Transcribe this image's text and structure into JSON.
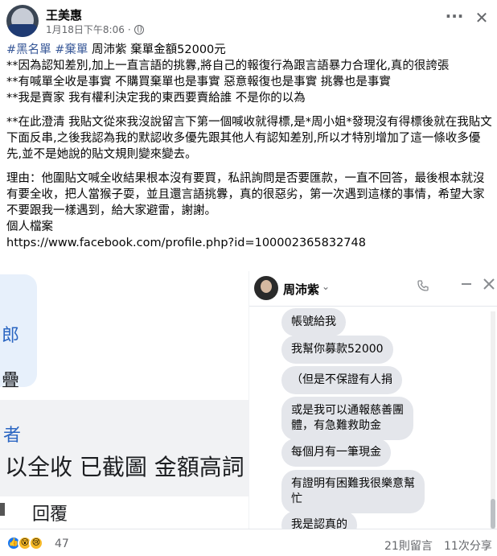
{
  "post": {
    "author": "王美惠",
    "timestamp": "1月18日下午8:06",
    "more_label": "···",
    "close_label": "✕",
    "line1_tag1": "#黑名單",
    "line1_tag2": "#棄單",
    "line1_rest": " 周沛紫 棄單金額52000元",
    "line2": "**因為認知差別,加上一直言語的挑釁,將自己的報復行為跟言語暴力合理化,真的很誇張",
    "line3": "**有喊單全收是事實 不購買棄單也是事實 惡意報復也是事實 挑釁也是事實",
    "line4": "**我是賣家 我有權利決定我的東西要賣給誰 不是你的以為",
    "para2": "**在此澄清 我貼文從來我沒說留言下第一個喊收就得標,是*周小姐*發現沒有得標後就在我貼文下面反串,之後我認為我的默認收多優先跟其他人有認知差別,所以才特別增加了這一條收多優先,並不是她說的貼文規則變來變去。",
    "para3": "理由：他圍貼文喊全收結果根本沒有要買，私訊詢問是否要匯款，一直不回答，最後根本就沒有要全收，把人當猴子耍，並且還言語挑釁，真的很惡劣，第一次遇到這樣的事情，希望大家不要跟我一樣遇到，給大家避雷，謝謝。",
    "para4": "個人檔案",
    "link": "https://www.facebook.com/profile.php?id=100002365832748"
  },
  "left_screenshot": {
    "char1": "郎",
    "char2": "疊",
    "blue_label": "者",
    "big_text": "以全收 已截圖 金額高詞",
    "reply": "回覆"
  },
  "chat": {
    "name": "周沛紫",
    "caret": "⌄",
    "messages": [
      "帳號給我",
      "我幫你募款52000",
      "（但是不保證有人捐",
      "或是我可以通報慈善團\n體，有急難救助金",
      "每個月有一筆現金",
      "有證明有困難我很樂意幫\n忙",
      "我是認真的"
    ]
  },
  "footer": {
    "reaction_count": "47",
    "comments": "21則留言",
    "shares": "11次分享"
  }
}
